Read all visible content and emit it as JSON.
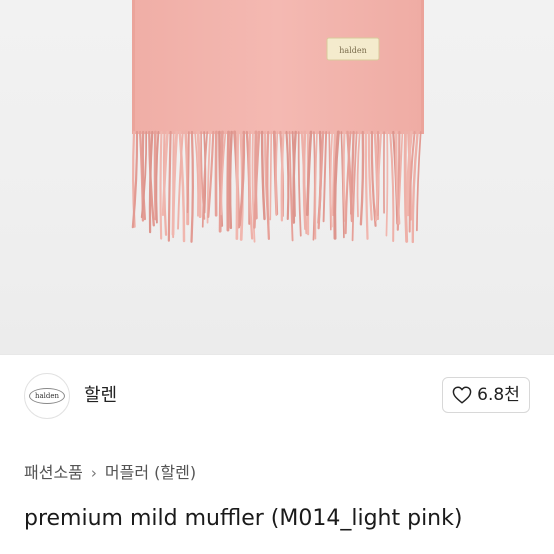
{
  "product_image": {
    "label_tag": "halden",
    "colors": {
      "background": "#f0f0f0",
      "fabric": "#f2b5ae",
      "fringe": "#e9a59e",
      "tag": "#f3e9c9"
    }
  },
  "brand": {
    "logo_text": "halden",
    "name": "할렌"
  },
  "like": {
    "icon": "heart-icon",
    "count": "6.8천"
  },
  "breadcrumb": {
    "category": "패션소품",
    "separator": "›",
    "subcategory": "머플러 (할렌)"
  },
  "product": {
    "title": "premium mild muffler (M014_light pink)"
  }
}
